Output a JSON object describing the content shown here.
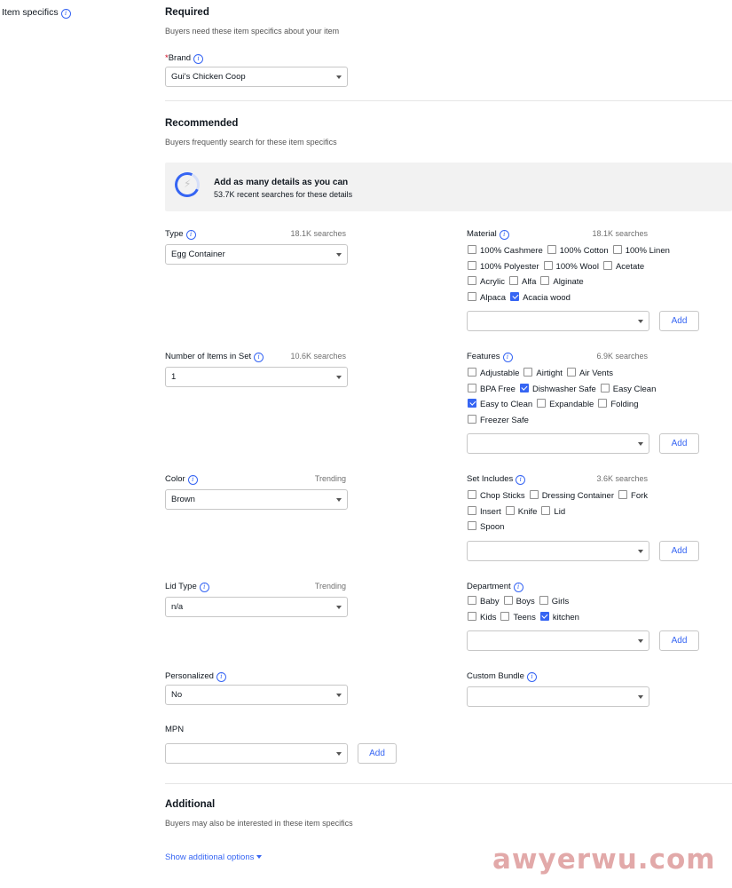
{
  "sidebar": {
    "label": "Item specifics"
  },
  "required": {
    "title": "Required",
    "subtitle": "Buyers need these item specifics about your item",
    "brand": {
      "star": "*",
      "label": "Brand",
      "value": "Gui's Chicken Coop"
    }
  },
  "recommended": {
    "title": "Recommended",
    "subtitle": "Buyers frequently search for these item specifics",
    "banner": {
      "title": "Add as many details as you can",
      "subtitle": "53.7K recent searches for these details",
      "progress_fraction": 0.75
    }
  },
  "fields": {
    "type": {
      "label": "Type",
      "meta": "18.1K searches",
      "value": "Egg Container"
    },
    "number_items": {
      "label": "Number of Items in Set",
      "meta": "10.6K searches",
      "value": "1"
    },
    "color": {
      "label": "Color",
      "meta": "Trending",
      "value": "Brown"
    },
    "lid_type": {
      "label": "Lid Type",
      "meta": "Trending",
      "value": "n/a"
    },
    "personalized": {
      "label": "Personalized",
      "value": "No"
    },
    "mpn": {
      "label": "MPN",
      "value": ""
    },
    "custom_bundle": {
      "label": "Custom Bundle",
      "value": ""
    },
    "material": {
      "label": "Material",
      "meta": "18.1K searches",
      "rows": [
        [
          {
            "label": "100% Cashmere",
            "checked": false
          },
          {
            "label": "100% Cotton",
            "checked": false
          },
          {
            "label": "100% Linen",
            "checked": false
          }
        ],
        [
          {
            "label": "100% Polyester",
            "checked": false
          },
          {
            "label": "100% Wool",
            "checked": false
          },
          {
            "label": "Acetate",
            "checked": false
          }
        ],
        [
          {
            "label": "Acrylic",
            "checked": false
          },
          {
            "label": "Alfa",
            "checked": false
          },
          {
            "label": "Alginate",
            "checked": false
          }
        ],
        [
          {
            "label": "Alpaca",
            "checked": false
          },
          {
            "label": "Acacia wood",
            "checked": true
          }
        ]
      ]
    },
    "features": {
      "label": "Features",
      "meta": "6.9K searches",
      "rows": [
        [
          {
            "label": "Adjustable",
            "checked": false
          },
          {
            "label": "Airtight",
            "checked": false
          },
          {
            "label": "Air Vents",
            "checked": false
          }
        ],
        [
          {
            "label": "BPA Free",
            "checked": false
          },
          {
            "label": "Dishwasher Safe",
            "checked": true
          },
          {
            "label": "Easy Clean",
            "checked": false
          }
        ],
        [
          {
            "label": "Easy to Clean",
            "checked": true
          },
          {
            "label": "Expandable",
            "checked": false
          },
          {
            "label": "Folding",
            "checked": false
          }
        ],
        [
          {
            "label": "Freezer Safe",
            "checked": false
          }
        ]
      ]
    },
    "set_includes": {
      "label": "Set Includes",
      "meta": "3.6K searches",
      "rows": [
        [
          {
            "label": "Chop Sticks",
            "checked": false
          },
          {
            "label": "Dressing Container",
            "checked": false
          },
          {
            "label": "Fork",
            "checked": false
          }
        ],
        [
          {
            "label": "Insert",
            "checked": false
          },
          {
            "label": "Knife",
            "checked": false
          },
          {
            "label": "Lid",
            "checked": false
          }
        ],
        [
          {
            "label": "Spoon",
            "checked": false
          }
        ]
      ]
    },
    "department": {
      "label": "Department",
      "rows": [
        [
          {
            "label": "Baby",
            "checked": false
          },
          {
            "label": "Boys",
            "checked": false
          },
          {
            "label": "Girls",
            "checked": false
          }
        ],
        [
          {
            "label": "Kids",
            "checked": false
          },
          {
            "label": "Teens",
            "checked": false
          },
          {
            "label": "kitchen",
            "checked": true
          }
        ]
      ]
    }
  },
  "add_label": "Add",
  "additional": {
    "title": "Additional",
    "subtitle": "Buyers may also be interested in these item specifics",
    "link": "Show additional options"
  },
  "watermark": "awyerwu.com",
  "colors": {
    "accent": "#3665f3",
    "required_star": "#d0021b",
    "banner_bg": "#f2f2f2"
  }
}
